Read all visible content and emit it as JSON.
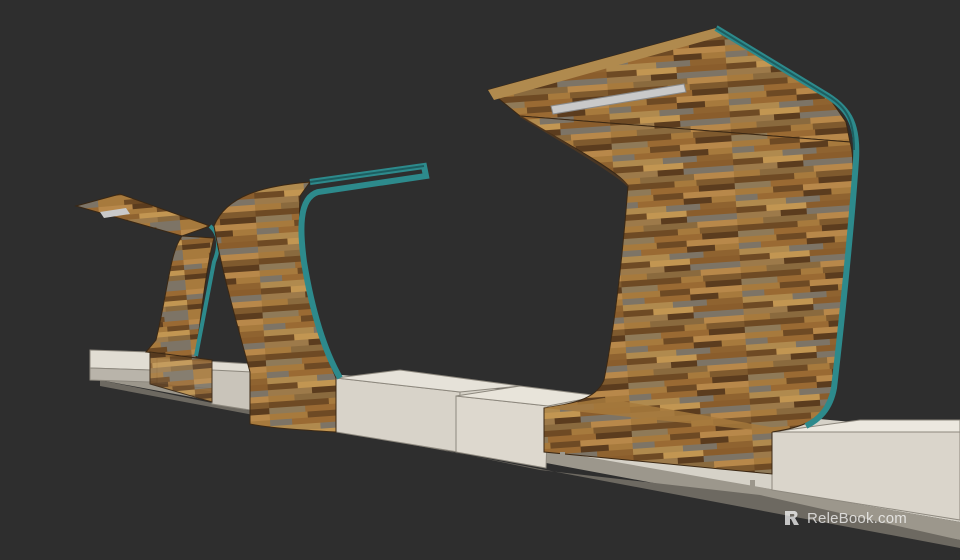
{
  "scene": {
    "subject": "wooden-canopy-bench-render",
    "colors": {
      "background": "#2e2e2e",
      "wood_light": "#a77a3d",
      "wood_mid": "#8a5d2c",
      "wood_dark": "#5b3c1e",
      "wood_grey": "#7d7466",
      "teal_trim": "#2d8a8c",
      "concrete_top": "#dedad0",
      "concrete_side": "#bdb8ad",
      "light_strip": "#c9c9c9"
    }
  },
  "watermark": {
    "brand": "ReleBook.com",
    "icon": "relebook-logo-icon"
  }
}
